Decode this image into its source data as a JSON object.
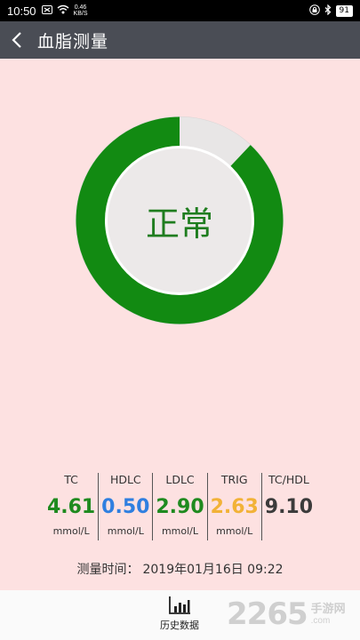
{
  "status_bar": {
    "time": "10:50",
    "net_speed_top": "0.46",
    "net_speed_bottom": "KB/S",
    "battery": "91"
  },
  "app_bar": {
    "title": "血脂测量"
  },
  "gauge": {
    "status_label": "正常",
    "progress": 0.88,
    "color": "#128a12"
  },
  "metrics": [
    {
      "name": "TC",
      "value": "4.61",
      "unit": "mmol/L",
      "color": "#1f8a1f"
    },
    {
      "name": "HDLC",
      "value": "0.50",
      "unit": "mmol/L",
      "color": "#2f7fe0"
    },
    {
      "name": "LDLC",
      "value": "2.90",
      "unit": "mmol/L",
      "color": "#1f8a1f"
    },
    {
      "name": "TRIG",
      "value": "2.63",
      "unit": "mmol/L",
      "color": "#f2b237"
    },
    {
      "name": "TC/HDL",
      "value": "9.10",
      "unit": "",
      "color": "#3b3b3b"
    }
  ],
  "measure_time": {
    "label": "测量时间：",
    "value": "2019年01月16日 09:22"
  },
  "bottom_bar": {
    "history_label": "历史数据"
  },
  "watermark": {
    "number": "2265",
    "suffix_top": "手游网",
    "suffix_bottom": ".com"
  }
}
